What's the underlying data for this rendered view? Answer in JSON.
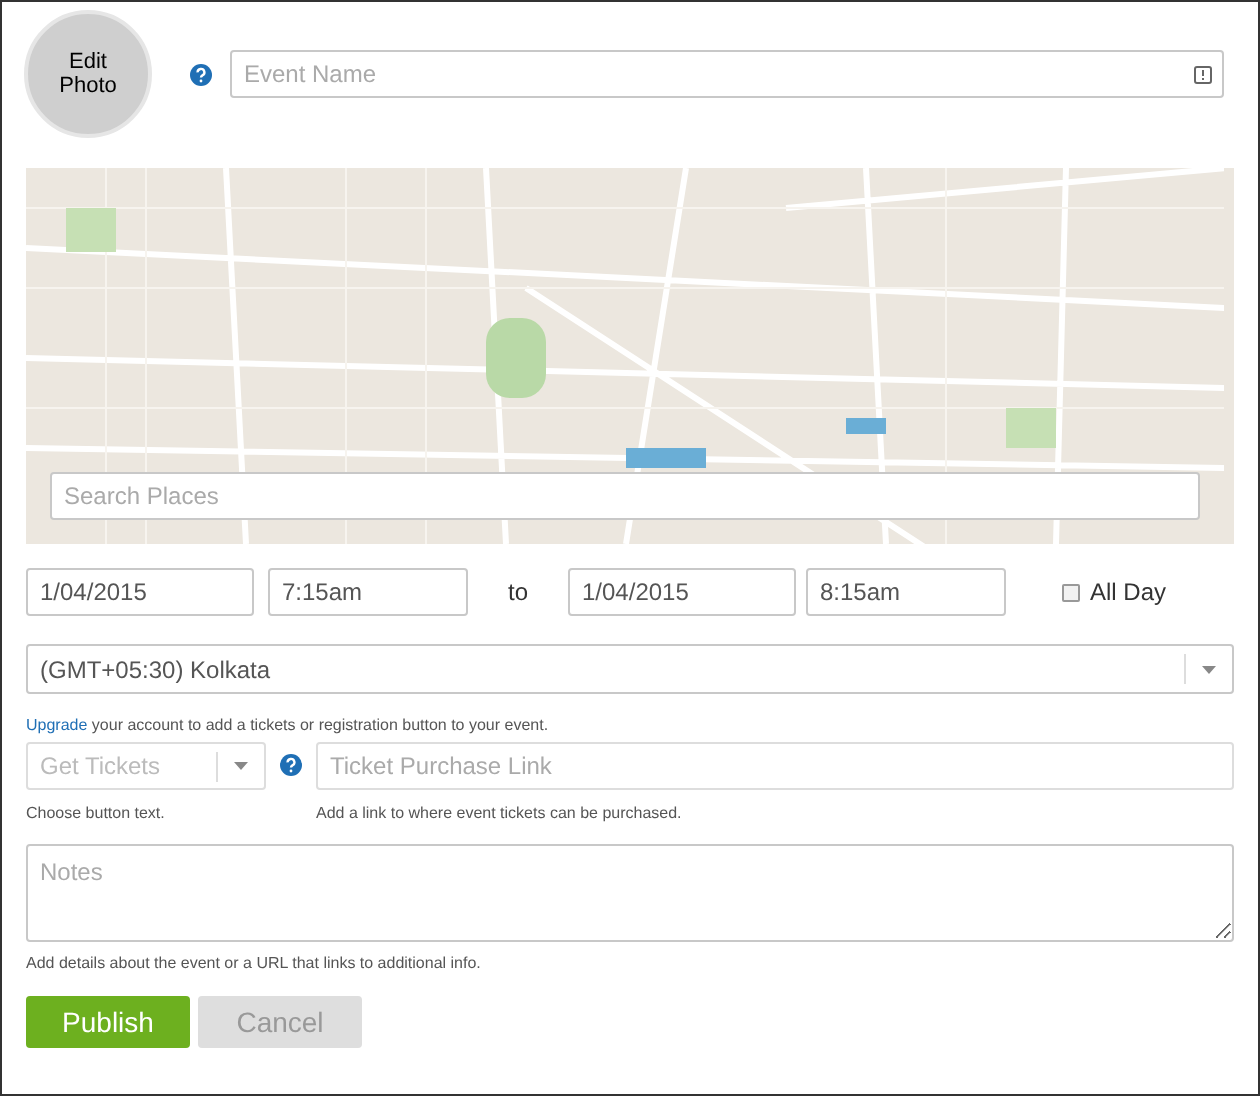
{
  "photo": {
    "label": "Edit Photo"
  },
  "event_name": {
    "placeholder": "Event Name"
  },
  "map": {
    "search": {
      "placeholder": "Search Places"
    }
  },
  "dates": {
    "start_date": "1/04/2015",
    "start_time": "7:15am",
    "separator": "to",
    "end_date": "1/04/2015",
    "end_time": "8:15am",
    "all_day": {
      "label": "All Day",
      "checked": false
    }
  },
  "timezone": {
    "value": "(GMT+05:30) Kolkata"
  },
  "upgrade_notice": {
    "link": "Upgrade",
    "text": "your account to add a tickets or registration button to your event."
  },
  "tickets": {
    "button_text": {
      "placeholder": "Get Tickets",
      "disabled": true,
      "hint": "Choose button text."
    },
    "link": {
      "placeholder": "Ticket Purchase Link",
      "disabled": true,
      "hint": "Add a link to where event tickets can be purchased."
    }
  },
  "notes": {
    "placeholder": "Notes",
    "hint": "Add details about the event or a URL that links to additional info."
  },
  "buttons": [
    {
      "label": "Publish",
      "kind": "primary"
    },
    {
      "label": "Cancel",
      "kind": "secondary"
    }
  ]
}
